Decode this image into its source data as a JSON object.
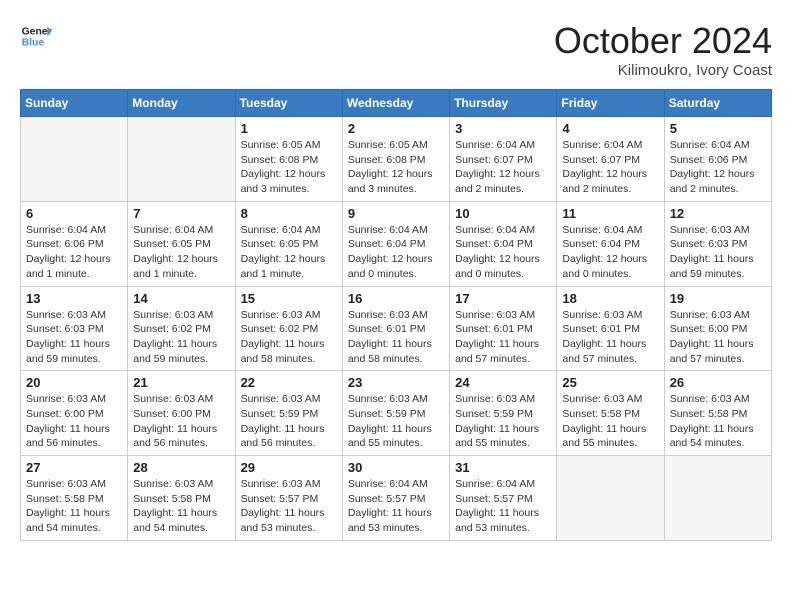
{
  "header": {
    "logo_line1": "General",
    "logo_line2": "Blue",
    "month_title": "October 2024",
    "location": "Kilimoukro, Ivory Coast"
  },
  "weekdays": [
    "Sunday",
    "Monday",
    "Tuesday",
    "Wednesday",
    "Thursday",
    "Friday",
    "Saturday"
  ],
  "weeks": [
    [
      {
        "day": "",
        "empty": true
      },
      {
        "day": "",
        "empty": true
      },
      {
        "day": "1",
        "info": "Sunrise: 6:05 AM\nSunset: 6:08 PM\nDaylight: 12 hours and 3 minutes."
      },
      {
        "day": "2",
        "info": "Sunrise: 6:05 AM\nSunset: 6:08 PM\nDaylight: 12 hours and 3 minutes."
      },
      {
        "day": "3",
        "info": "Sunrise: 6:04 AM\nSunset: 6:07 PM\nDaylight: 12 hours and 2 minutes."
      },
      {
        "day": "4",
        "info": "Sunrise: 6:04 AM\nSunset: 6:07 PM\nDaylight: 12 hours and 2 minutes."
      },
      {
        "day": "5",
        "info": "Sunrise: 6:04 AM\nSunset: 6:06 PM\nDaylight: 12 hours and 2 minutes."
      }
    ],
    [
      {
        "day": "6",
        "info": "Sunrise: 6:04 AM\nSunset: 6:06 PM\nDaylight: 12 hours and 1 minute."
      },
      {
        "day": "7",
        "info": "Sunrise: 6:04 AM\nSunset: 6:05 PM\nDaylight: 12 hours and 1 minute."
      },
      {
        "day": "8",
        "info": "Sunrise: 6:04 AM\nSunset: 6:05 PM\nDaylight: 12 hours and 1 minute."
      },
      {
        "day": "9",
        "info": "Sunrise: 6:04 AM\nSunset: 6:04 PM\nDaylight: 12 hours and 0 minutes."
      },
      {
        "day": "10",
        "info": "Sunrise: 6:04 AM\nSunset: 6:04 PM\nDaylight: 12 hours and 0 minutes."
      },
      {
        "day": "11",
        "info": "Sunrise: 6:04 AM\nSunset: 6:04 PM\nDaylight: 12 hours and 0 minutes."
      },
      {
        "day": "12",
        "info": "Sunrise: 6:03 AM\nSunset: 6:03 PM\nDaylight: 11 hours and 59 minutes."
      }
    ],
    [
      {
        "day": "13",
        "info": "Sunrise: 6:03 AM\nSunset: 6:03 PM\nDaylight: 11 hours and 59 minutes."
      },
      {
        "day": "14",
        "info": "Sunrise: 6:03 AM\nSunset: 6:02 PM\nDaylight: 11 hours and 59 minutes."
      },
      {
        "day": "15",
        "info": "Sunrise: 6:03 AM\nSunset: 6:02 PM\nDaylight: 11 hours and 58 minutes."
      },
      {
        "day": "16",
        "info": "Sunrise: 6:03 AM\nSunset: 6:01 PM\nDaylight: 11 hours and 58 minutes."
      },
      {
        "day": "17",
        "info": "Sunrise: 6:03 AM\nSunset: 6:01 PM\nDaylight: 11 hours and 57 minutes."
      },
      {
        "day": "18",
        "info": "Sunrise: 6:03 AM\nSunset: 6:01 PM\nDaylight: 11 hours and 57 minutes."
      },
      {
        "day": "19",
        "info": "Sunrise: 6:03 AM\nSunset: 6:00 PM\nDaylight: 11 hours and 57 minutes."
      }
    ],
    [
      {
        "day": "20",
        "info": "Sunrise: 6:03 AM\nSunset: 6:00 PM\nDaylight: 11 hours and 56 minutes."
      },
      {
        "day": "21",
        "info": "Sunrise: 6:03 AM\nSunset: 6:00 PM\nDaylight: 11 hours and 56 minutes."
      },
      {
        "day": "22",
        "info": "Sunrise: 6:03 AM\nSunset: 5:59 PM\nDaylight: 11 hours and 56 minutes."
      },
      {
        "day": "23",
        "info": "Sunrise: 6:03 AM\nSunset: 5:59 PM\nDaylight: 11 hours and 55 minutes."
      },
      {
        "day": "24",
        "info": "Sunrise: 6:03 AM\nSunset: 5:59 PM\nDaylight: 11 hours and 55 minutes."
      },
      {
        "day": "25",
        "info": "Sunrise: 6:03 AM\nSunset: 5:58 PM\nDaylight: 11 hours and 55 minutes."
      },
      {
        "day": "26",
        "info": "Sunrise: 6:03 AM\nSunset: 5:58 PM\nDaylight: 11 hours and 54 minutes."
      }
    ],
    [
      {
        "day": "27",
        "info": "Sunrise: 6:03 AM\nSunset: 5:58 PM\nDaylight: 11 hours and 54 minutes."
      },
      {
        "day": "28",
        "info": "Sunrise: 6:03 AM\nSunset: 5:58 PM\nDaylight: 11 hours and 54 minutes."
      },
      {
        "day": "29",
        "info": "Sunrise: 6:03 AM\nSunset: 5:57 PM\nDaylight: 11 hours and 53 minutes."
      },
      {
        "day": "30",
        "info": "Sunrise: 6:04 AM\nSunset: 5:57 PM\nDaylight: 11 hours and 53 minutes."
      },
      {
        "day": "31",
        "info": "Sunrise: 6:04 AM\nSunset: 5:57 PM\nDaylight: 11 hours and 53 minutes."
      },
      {
        "day": "",
        "empty": true
      },
      {
        "day": "",
        "empty": true
      }
    ]
  ]
}
